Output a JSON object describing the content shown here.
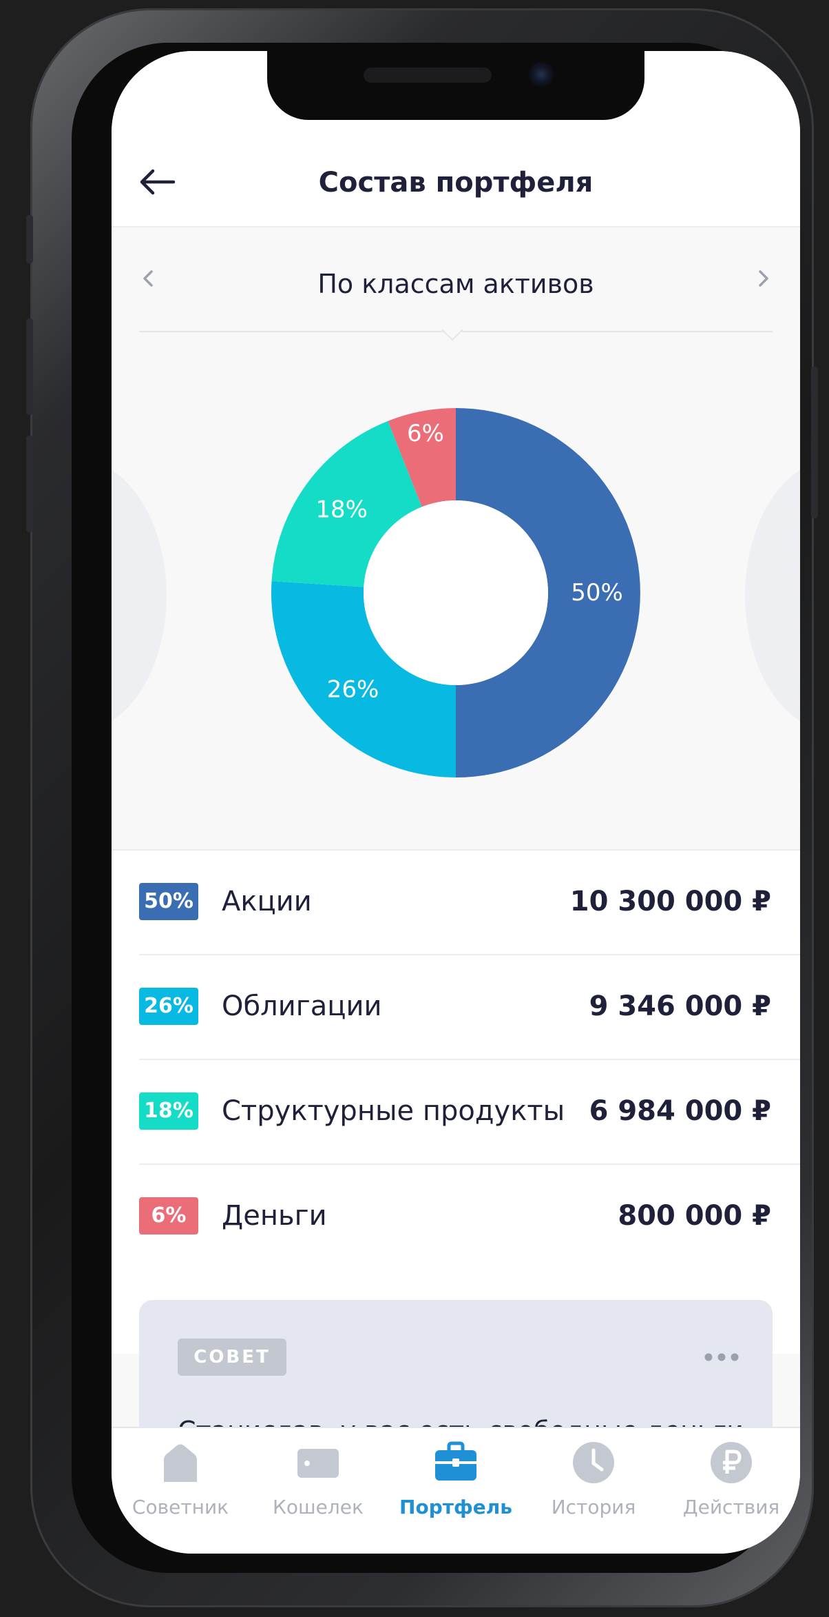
{
  "header": {
    "title": "Состав портфеля",
    "back_icon": "arrow-left-icon"
  },
  "switcher": {
    "label": "По классам активов",
    "prev_icon": "chevron-left-icon",
    "next_icon": "chevron-right-icon"
  },
  "colors": {
    "stocks": "#3b6db3",
    "bonds": "#08b9e2",
    "structured": "#14dcc6",
    "cash": "#ea6d77",
    "active_tab": "#1f8fd6"
  },
  "chart_data": {
    "type": "pie",
    "variant": "donut",
    "slices": [
      {
        "label": "50%",
        "value": 50,
        "color": "#3b6db3"
      },
      {
        "label": "26%",
        "value": 26,
        "color": "#08b9e2"
      },
      {
        "label": "18%",
        "value": 18,
        "color": "#14dcc6"
      },
      {
        "label": "6%",
        "value": 6,
        "color": "#ea6d77"
      }
    ]
  },
  "assets": [
    {
      "percent": "50%",
      "name": "Акции",
      "amount": "10 300 000 ₽",
      "color": "#3b6db3"
    },
    {
      "percent": "26%",
      "name": "Облигации",
      "amount": "9 346 000 ₽",
      "color": "#08b9e2"
    },
    {
      "percent": "18%",
      "name": "Структурные продукты",
      "amount": "6 984 000 ₽",
      "color": "#14dcc6"
    },
    {
      "percent": "6%",
      "name": "Деньги",
      "amount": "800 000 ₽",
      "color": "#ea6d77"
    }
  ],
  "tip": {
    "badge": "СОВЕТ",
    "more_icon": "more-icon",
    "text": "Станислав, у вас есть свободные деньги —"
  },
  "tabbar": {
    "tabs": [
      {
        "label": "Советник",
        "icon": "house-icon"
      },
      {
        "label": "Кошелек",
        "icon": "wallet-icon"
      },
      {
        "label": "Портфель",
        "icon": "briefcase-icon",
        "active": true
      },
      {
        "label": "История",
        "icon": "clock-icon"
      },
      {
        "label": "Действия",
        "icon": "ruble-icon"
      }
    ]
  }
}
